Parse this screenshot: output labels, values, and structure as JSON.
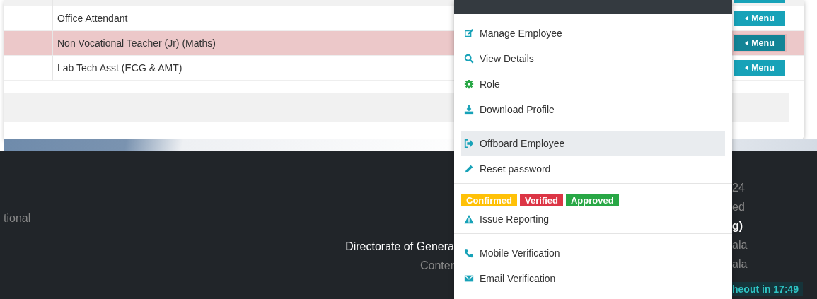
{
  "table": {
    "rows": [
      {
        "title": "Office Attendant",
        "selected": false,
        "menu_button": "Menu"
      },
      {
        "title": "Non Vocational Teacher (Jr) (Maths)",
        "selected": true,
        "menu_button": "Menu"
      },
      {
        "title": "Lab Tech Asst (ECG & AMT)",
        "selected": false,
        "menu_button": "Menu"
      }
    ]
  },
  "dropdown": {
    "sections": [
      {
        "kind": "items",
        "items": [
          {
            "label": "Manage Employee",
            "kind": "edit",
            "selected": false
          },
          {
            "label": "View Details",
            "kind": "search",
            "selected": false
          },
          {
            "label": "Role",
            "kind": "gear",
            "selected": false
          },
          {
            "label": "Download Profile",
            "kind": "download",
            "selected": false
          }
        ]
      },
      {
        "kind": "items",
        "items": [
          {
            "label": "Offboard Employee",
            "kind": "signout",
            "selected": true
          },
          {
            "label": "Reset password",
            "kind": "pencil",
            "selected": false
          }
        ]
      },
      {
        "kind": "badges",
        "badges": [
          {
            "label": "Confirmed",
            "color": "#ffc107"
          },
          {
            "label": "Verified",
            "color": "#dc3545"
          },
          {
            "label": "Approved",
            "color": "#28a745"
          }
        ],
        "items": [
          {
            "label": "Issue Reporting",
            "kind": "warning",
            "selected": false
          }
        ]
      },
      {
        "kind": "items",
        "items": [
          {
            "label": "Mobile Verification",
            "kind": "phone",
            "selected": false
          },
          {
            "label": "Email Verification",
            "kind": "envelope",
            "selected": false
          }
        ]
      }
    ]
  },
  "footer": {
    "left": [
      {
        "text": "tional",
        "kind": "muted"
      },
      {
        "text": "Directorate of Genera",
        "kind": "strong"
      },
      {
        "text": "Conter",
        "kind": "muted"
      }
    ],
    "right": [
      {
        "text": "24",
        "kind": "muted"
      },
      {
        "text": "ed",
        "kind": "muted"
      },
      {
        "text": "g)",
        "kind": "strong"
      },
      {
        "text": "ala",
        "kind": "muted"
      },
      {
        "text": "ala",
        "kind": "muted"
      }
    ],
    "session_timer": "heout in 17:49"
  }
}
